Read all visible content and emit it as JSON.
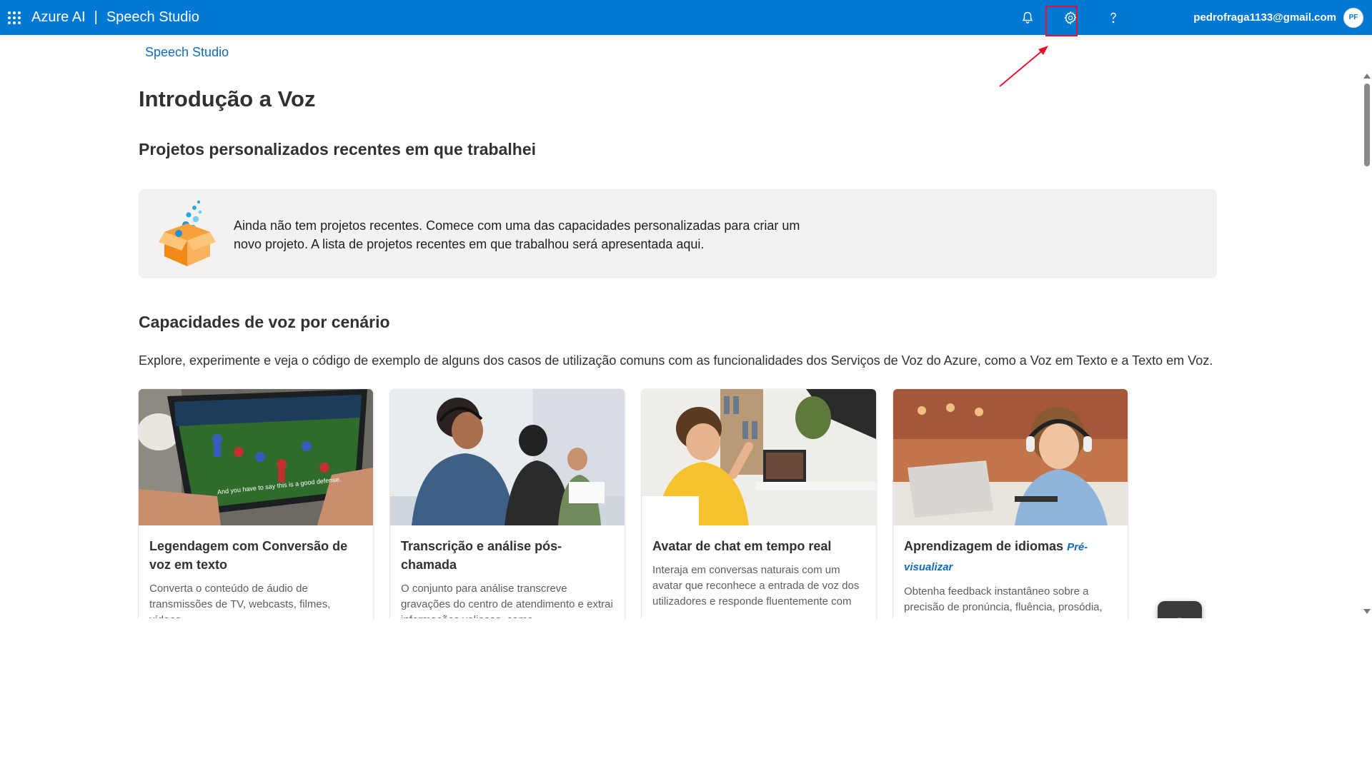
{
  "topbar": {
    "brand": "Azure AI",
    "separator": "|",
    "product": "Speech Studio",
    "user_email": "pedrofraga1133@gmail.com",
    "avatar_initials": "PF",
    "bg_color": "#0078d4",
    "icons": [
      "waffle-icon",
      "bell-icon",
      "gear-icon",
      "help-icon"
    ]
  },
  "breadcrumb": "Speech Studio",
  "page_title": "Introdução a Voz",
  "recent": {
    "title": "Projetos personalizados recentes em que trabalhei",
    "empty_message": "Ainda não tem projetos recentes. Comece com uma das capacidades personalizadas para criar um novo projeto. A lista de projetos recentes em que trabalhou será apresentada aqui."
  },
  "capabilities": {
    "title": "Capacidades de voz por cenário",
    "description": "Explore, experimente e veja o código de exemplo de alguns dos casos de utilização comuns com as funcionalidades dos Serviços de Voz do Azure, como a Voz em Texto e a Texto em Voz.",
    "cards": [
      {
        "title": "Legendagem com Conversão de voz em texto",
        "preview": "",
        "description": "Converta o conteúdo de áudio de transmissões de TV, webcasts, filmes, vídeos,",
        "image_caption": "And you have to say this is a good defense."
      },
      {
        "title": "Transcrição e análise pós-chamada",
        "preview": "",
        "description": "O conjunto para análise transcreve gravações do centro de atendimento e extrai informações valiosas, como"
      },
      {
        "title": "Avatar de chat em tempo real",
        "preview": "",
        "description": "Interaja em conversas naturais com um avatar que reconhece a entrada de voz dos utilizadores e responde fluentemente com"
      },
      {
        "title": "Aprendizagem de idiomas",
        "preview": "Pré-visualizar",
        "description": "Obtenha feedback instantâneo sobre a precisão de pronúncia, fluência, prosódia,"
      }
    ]
  },
  "annotation": {
    "highlight_color": "#e8112d"
  }
}
